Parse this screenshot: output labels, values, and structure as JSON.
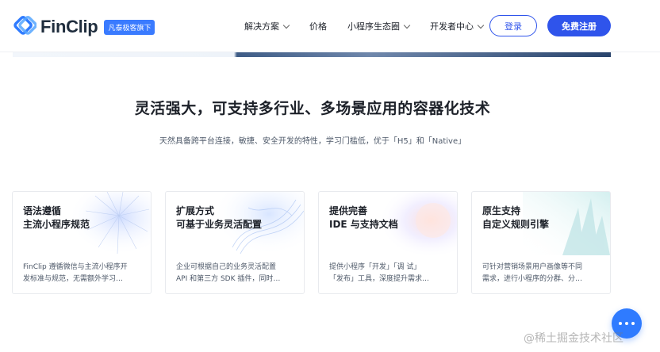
{
  "header": {
    "logo_text": "FinClip",
    "logo_badge": "凡泰极客旗下",
    "nav": [
      {
        "label": "解决方案",
        "has_dropdown": true
      },
      {
        "label": "价格",
        "has_dropdown": false
      },
      {
        "label": "小程序生态圈",
        "has_dropdown": true
      },
      {
        "label": "开发者中心",
        "has_dropdown": true
      }
    ],
    "login_label": "登录",
    "register_label": "免费注册"
  },
  "section": {
    "title": "灵活强大，可支持多行业、多场景应用的容器化技术",
    "subtitle": "天然具备跨平台连接，敏捷、安全开发的特性，学习门槛低，优于「H5」和「Native」"
  },
  "cards": [
    {
      "title_line1": "语法遵循",
      "title_line2": "主流小程序规范",
      "desc_line1": "FinClip 遵循微信与主流小程序开",
      "desc_line2": "发标准与规范，无需额外学习…"
    },
    {
      "title_line1": "扩展方式",
      "title_line2": "可基于业务灵活配置",
      "desc_line1": "企业可根据自己的业务灵活配置",
      "desc_line2": "API 和第三方 SDK 插件，同时…"
    },
    {
      "title_line1": "提供完善",
      "title_line2": "IDE 与支持文档",
      "desc_line1": "提供小程序「开发」「调 试」",
      "desc_line2": "「发布」工具，深度提升需求…"
    },
    {
      "title_line1": "原生支持",
      "title_line2": "自定义规则引擎",
      "desc_line1": "可针对营销场景用户画像等不同",
      "desc_line2": "需求，进行小程序的分群、分…"
    }
  ],
  "watermark": "@稀土掘金技术社区",
  "colors": {
    "brand": "#2f54eb",
    "float_button": "#2f7bff"
  },
  "icons": {
    "chat_button": "more-dots-icon",
    "logo": "finclip-logo-icon"
  }
}
